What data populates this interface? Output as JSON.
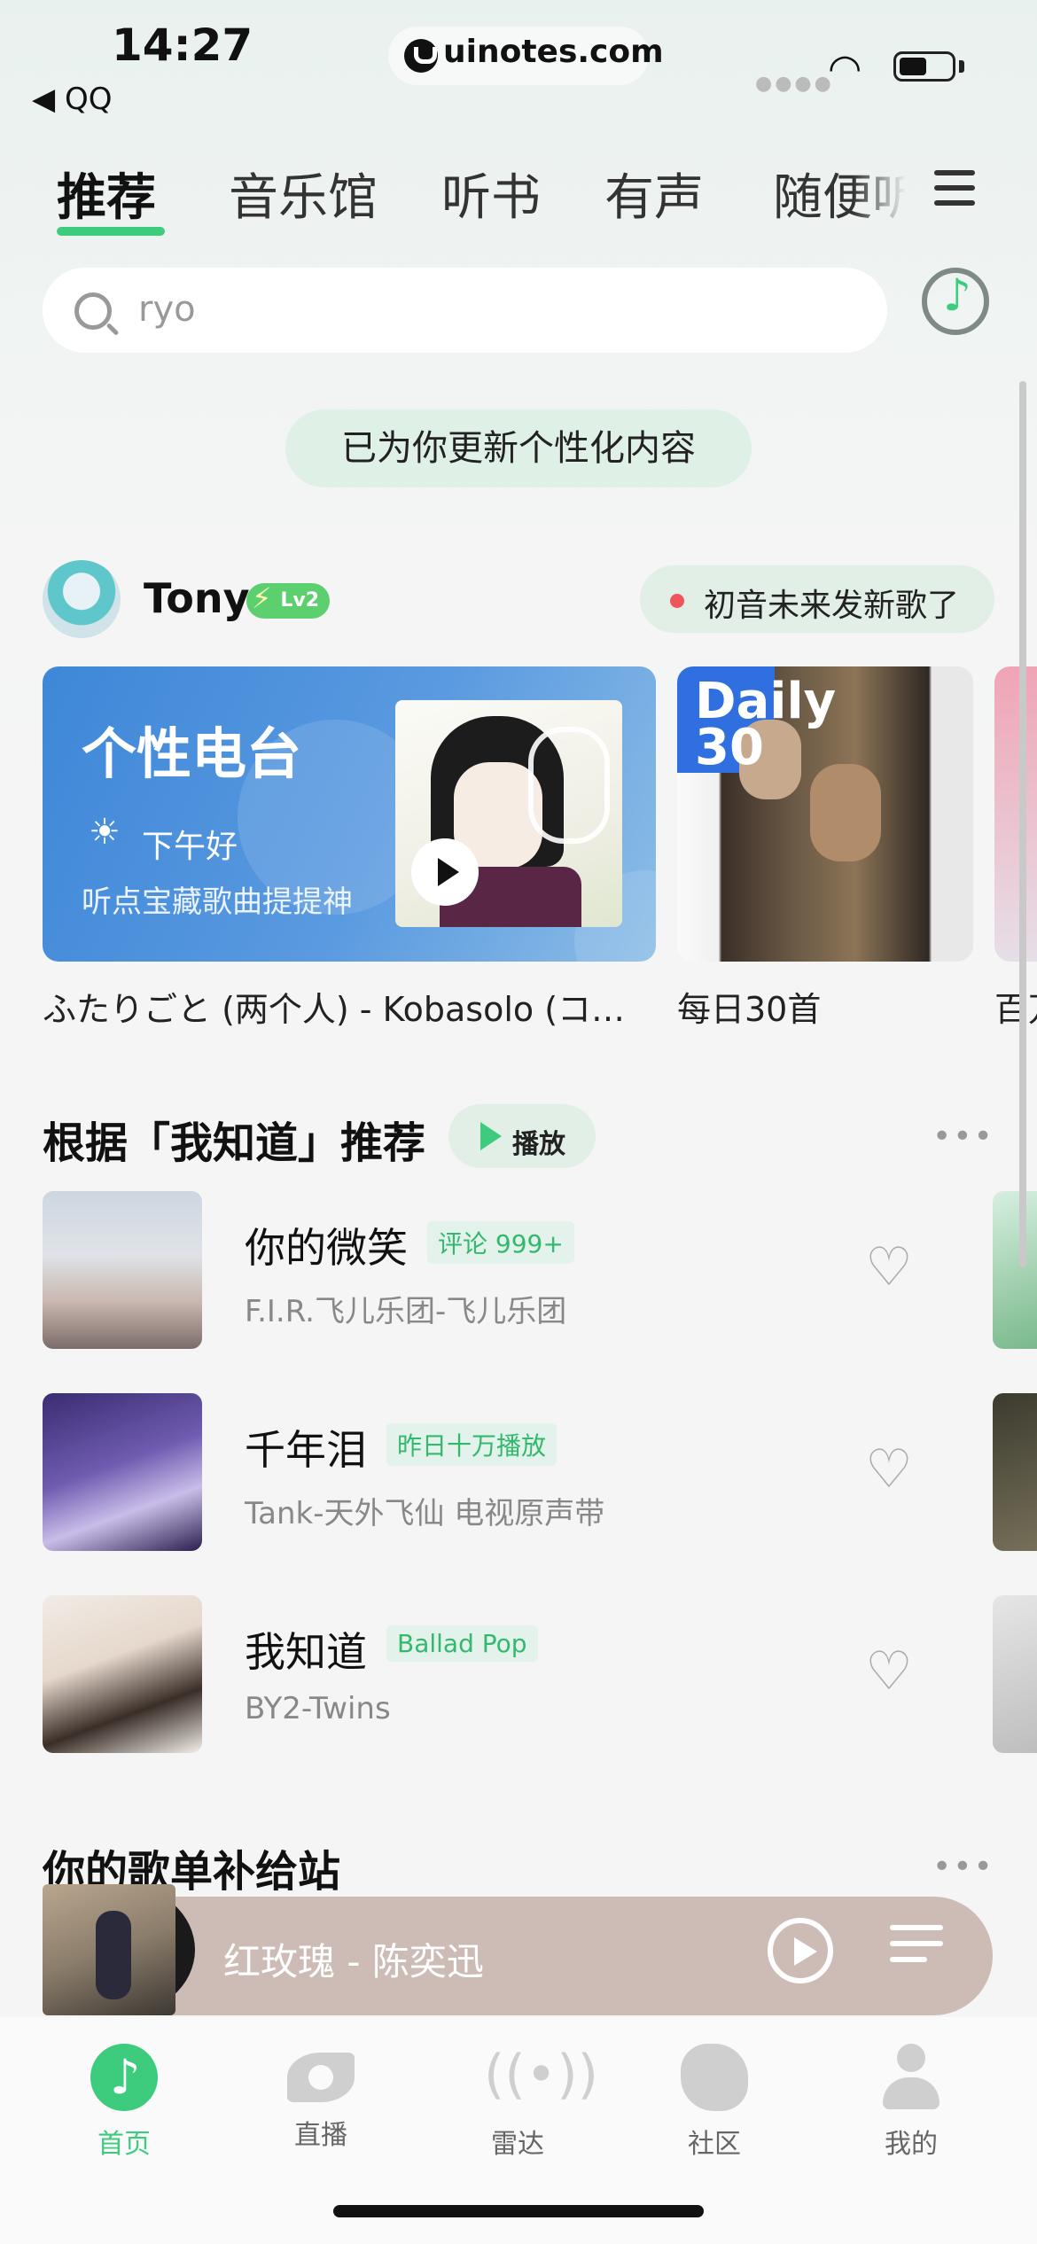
{
  "status": {
    "time": "14:27",
    "back_app": "◀ QQ",
    "url": "uinotes.com"
  },
  "tabs": [
    "推荐",
    "音乐馆",
    "听书",
    "有声",
    "随便听"
  ],
  "search": {
    "placeholder": "ryo"
  },
  "notice": "已为你更新个性化内容",
  "user": {
    "name": "Tony",
    "level": "Lv2",
    "new_song_text": "初音未来发新歌了"
  },
  "cards": {
    "radio": {
      "title": "个性电台",
      "greeting": "下午好",
      "subtitle": "听点宝藏歌曲提提神",
      "caption": "ふたりごと (两个人) - Kobasolo (コ…"
    },
    "daily": {
      "label_line1": "Daily",
      "label_line2": "30",
      "caption": "每日30首"
    },
    "peek_caption": "百万"
  },
  "section_recommend": {
    "title": "根据「我知道」推荐",
    "play_label": "播放",
    "songs": [
      {
        "title": "你的微笑",
        "tag": "评论 999+",
        "artist": "F.I.R.飞儿乐团-飞儿乐团"
      },
      {
        "title": "千年泪",
        "tag": "昨日十万播放",
        "artist": "Tank-天外飞仙 电视原声带"
      },
      {
        "title": "我知道",
        "tag": "Ballad Pop",
        "artist": "BY2-Twins"
      }
    ]
  },
  "section_playlist": {
    "title": "你的歌单补给站"
  },
  "player": {
    "song": "红玫瑰 - 陈奕迅"
  },
  "nav": [
    "首页",
    "直播",
    "雷达",
    "社区",
    "我的"
  ],
  "colors": {
    "accent": "#3dcc7e",
    "radio_card": "#4b8fdb",
    "player_bar": "#cdbcb5"
  }
}
